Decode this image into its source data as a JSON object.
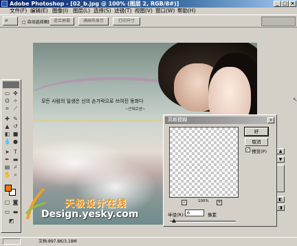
{
  "window": {
    "title": "Adobe Photoshop - [02_b.jpg @ 100% (图层 2, RGB/8#)]",
    "controls": [
      "_",
      "□",
      "×"
    ]
  },
  "menu": [
    "文件(F)",
    "编辑(E)",
    "图像(I)",
    "图层(L)",
    "选择(S)",
    "滤镜(T)",
    "视图(V)",
    "窗口(W)",
    "帮助(H)"
  ],
  "options": {
    "auto_select_label": "□ 自动选择图层",
    "buttons": [
      "适合屏幕",
      "满画布显示",
      "打印尺寸"
    ]
  },
  "canvas": {
    "korean_line": "모든 사람의 일생은 신의 손가락으로 쓰여진 동화다",
    "korean_author": "~안데르센~",
    "watermark_cn": "天极设计在线",
    "watermark_en": "Design.yesky.com"
  },
  "dialog": {
    "title": "高斯模糊",
    "ok_label": "好",
    "cancel_label": "取消",
    "preview_label": "预览(P)",
    "preview_checked": "✓",
    "zoom_value": "100%",
    "zoom_out": "-",
    "zoom_in": "+",
    "radius_label": "半径(R):",
    "radius_value": "6",
    "radius_unit": "像素",
    "slider_fraction": 0.06
  },
  "status": {
    "doc_info": "文档:897.8K/3.18M"
  },
  "colors": {
    "foreground": "#f07a00",
    "background": "#ffffff"
  }
}
